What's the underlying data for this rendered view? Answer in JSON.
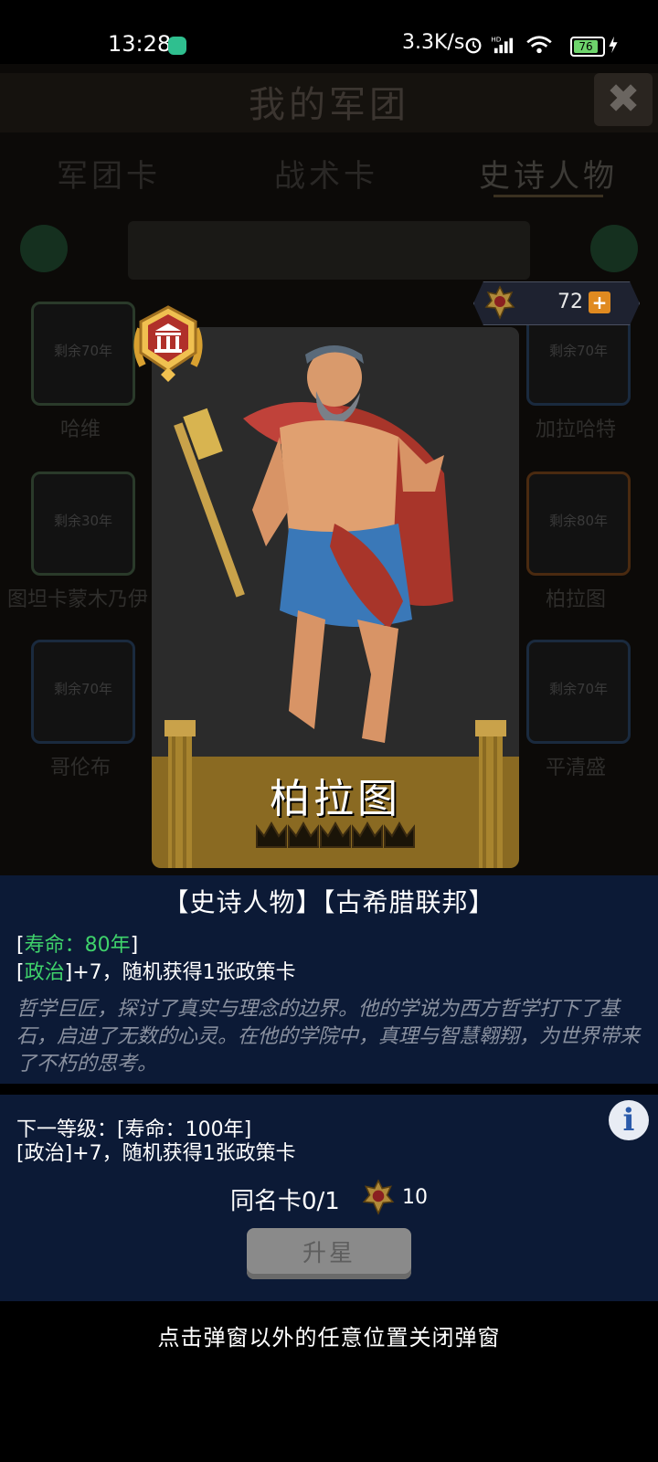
{
  "status_bar": {
    "time": "13:28",
    "network_speed": "3.3K/s",
    "battery": "76",
    "icons": [
      "alarm-icon",
      "hd-signal-icon",
      "wifi-icon",
      "battery-icon",
      "charging-icon"
    ]
  },
  "background": {
    "title": "我的军团",
    "close": "✖",
    "tabs": [
      "军团卡",
      "战术卡",
      "史诗人物"
    ],
    "active_tab": "史诗人物",
    "cards": [
      {
        "tag": "剩余70年",
        "name": "哈维"
      },
      {
        "tag": "剩余70年",
        "name": "加拉哈特"
      },
      {
        "tag": "剩余30年",
        "name": "图坦卡蒙木乃伊"
      },
      {
        "tag": "剩余80年",
        "name": "柏拉图"
      },
      {
        "tag": "剩余70年",
        "name": "哥伦布"
      },
      {
        "tag": "剩余70年",
        "name": "平清盛"
      }
    ]
  },
  "currency": {
    "value": "72",
    "plus": "+"
  },
  "card": {
    "name": "柏拉图",
    "stars_total": 5,
    "stars_filled": 0
  },
  "info": {
    "tags": "【史诗人物】【古希腊联邦】",
    "lifespan_open": "[",
    "lifespan": "寿命：80年",
    "lifespan_close": "]",
    "politics_open": "[",
    "politics": "政治",
    "politics_close": "]+7，随机获得1张政策卡",
    "description": "哲学巨匠，探讨了真实与理念的边界。他的学说为西方哲学打下了基石，启迪了无数的心灵。在他的学院中，真理与智慧翱翔，为世界带来了不朽的思考。"
  },
  "upgrade": {
    "next_level": "下一等级：[寿命：100年]",
    "next_effect": "[政治]+7，随机获得1张政策卡",
    "info_button": "i",
    "duplicate_label": "同名卡0/1",
    "cost": "10",
    "button": "升星"
  },
  "hint": "点击弹窗以外的任意位置关闭弹窗"
}
